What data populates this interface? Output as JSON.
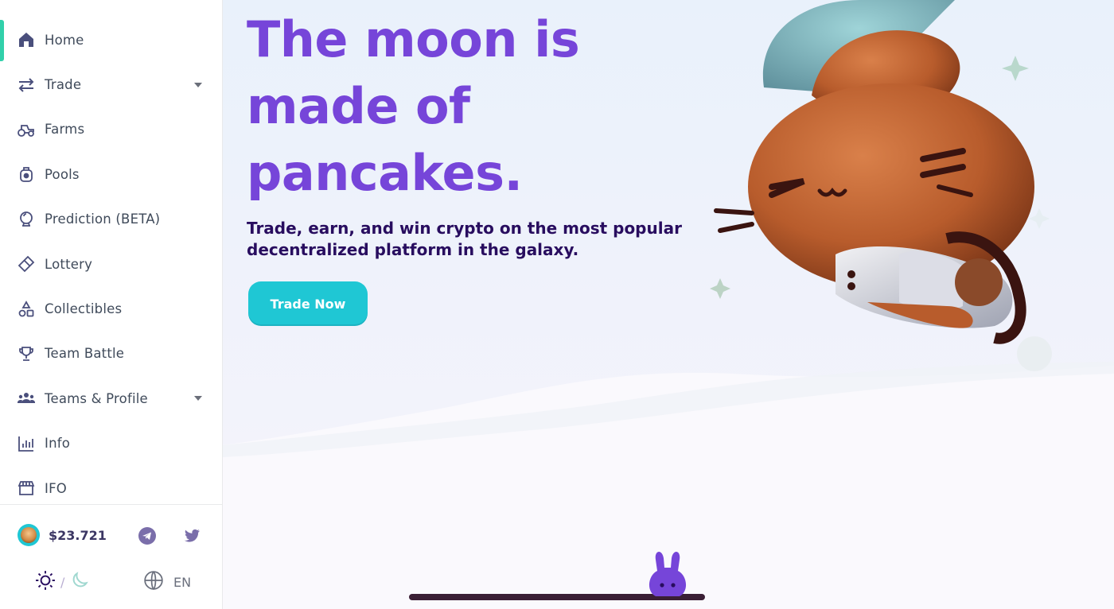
{
  "sidebar": {
    "items": [
      {
        "label": "Home",
        "icon": "home-icon",
        "active": true,
        "caret": false
      },
      {
        "label": "Trade",
        "icon": "trade-icon",
        "active": false,
        "caret": true
      },
      {
        "label": "Farms",
        "icon": "farm-icon",
        "active": false,
        "caret": false
      },
      {
        "label": "Pools",
        "icon": "pool-icon",
        "active": false,
        "caret": false
      },
      {
        "label": "Prediction (BETA)",
        "icon": "prediction-icon",
        "active": false,
        "caret": false
      },
      {
        "label": "Lottery",
        "icon": "ticket-icon",
        "active": false,
        "caret": false
      },
      {
        "label": "Collectibles",
        "icon": "nft-icon",
        "active": false,
        "caret": false
      },
      {
        "label": "Team Battle",
        "icon": "trophy-icon",
        "active": false,
        "caret": false
      },
      {
        "label": "Teams & Profile",
        "icon": "groups-icon",
        "active": false,
        "caret": true
      },
      {
        "label": "Info",
        "icon": "chart-icon",
        "active": false,
        "caret": false
      },
      {
        "label": "IFO",
        "icon": "ifo-icon",
        "active": false,
        "caret": false
      }
    ],
    "footer": {
      "price": "$23.721",
      "theme_separator": "/",
      "language": "EN"
    }
  },
  "hero": {
    "headline": "The moon is made of pancakes.",
    "subheadline": "Trade, earn, and win crypto on the most popular decentralized platform in the galaxy.",
    "cta_label": "Trade Now"
  },
  "colors": {
    "primary": "#1fc7d4",
    "secondary": "#7645d9",
    "text": "#280d5f",
    "active_indicator": "#31d0aa"
  }
}
